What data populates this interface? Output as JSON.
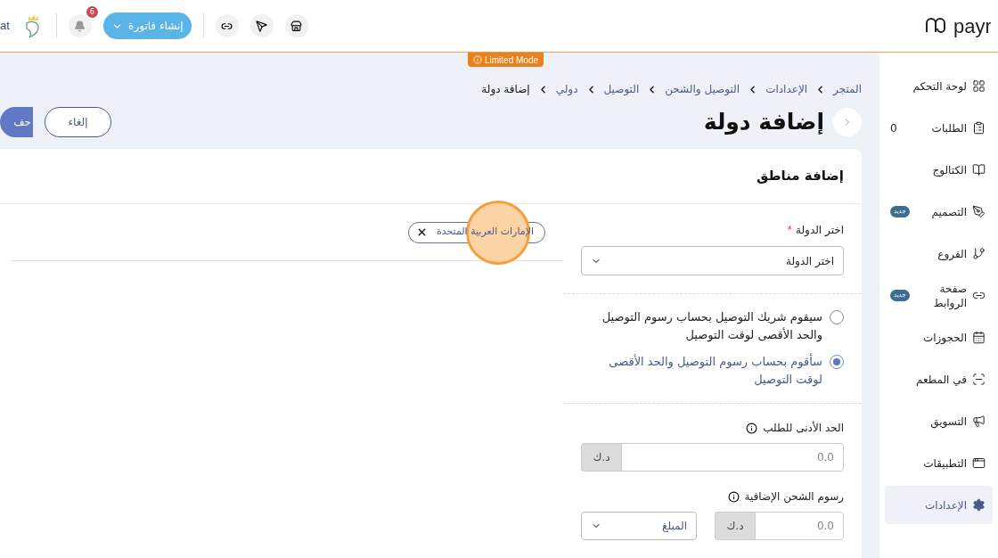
{
  "header": {
    "logo_text": "payr",
    "store_text": "at",
    "invoice_button": "إنشاء فاتورة",
    "notifications_count": "6"
  },
  "sidebar": {
    "items": [
      {
        "label": "لوحة التحكم",
        "selected": false
      },
      {
        "label": "الطلبات",
        "count": "0",
        "selected": false
      },
      {
        "label": "الكتالوج",
        "selected": false
      },
      {
        "label": "التصميم",
        "badge": "جديد",
        "selected": false
      },
      {
        "label": "الفروع",
        "selected": false
      },
      {
        "label": "صفحة الروابط",
        "badge": "جديد",
        "selected": false
      },
      {
        "label": "الحجوزات",
        "selected": false
      },
      {
        "label": "في المطعم",
        "selected": false
      },
      {
        "label": "التسويق",
        "selected": false
      },
      {
        "label": "التطبيقات",
        "selected": false
      },
      {
        "label": "الإعدادات",
        "selected": true
      }
    ]
  },
  "mode_badge": "Limited Mode",
  "breadcrumb": [
    "المتجر",
    "الإعدادات",
    "التوصيل والشحن",
    "التوصيل",
    "دولي",
    "إضافة دولة"
  ],
  "page_title": "إضافة دولة",
  "buttons": {
    "cancel": "إلغاء",
    "save": "حف"
  },
  "card": {
    "title": "إضافة مناطق",
    "country_label": "اختر الدولة",
    "country_required_mark": "*",
    "country_value": "اختر الدولة",
    "options": [
      {
        "label": "سيقوم شريك التوصيل بحساب رسوم التوصيل والحد الأقصى لوقت التوصيل",
        "selected": false
      },
      {
        "label": "سأقوم بحساب رسوم التوصيل والحد الأقصى لوقت التوصيل",
        "selected": true
      }
    ],
    "min_order": {
      "label": "الحد الأدنى للطلب",
      "placeholder": "0.0",
      "currency": "د.ك"
    },
    "extra_fees": {
      "label": "رسوم الشحن الإضافية",
      "placeholder": "0.0",
      "currency": "د.ك",
      "type_placeholder": "المبلغ"
    },
    "selected_countries": [
      {
        "label": "الإمارات العربية المتحدة"
      }
    ]
  }
}
